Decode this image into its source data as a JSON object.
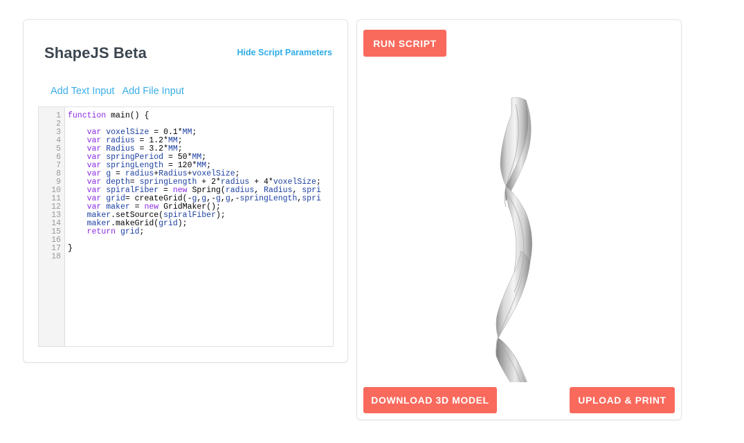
{
  "app": {
    "title": "ShapeJS Beta"
  },
  "left_panel": {
    "hide_params_label": "Hide Script Parameters",
    "add_text_input_label": "Add Text Input",
    "add_file_input_label": "Add File Input"
  },
  "editor": {
    "line_numbers": [
      "1",
      "2",
      "3",
      "4",
      "5",
      "6",
      "7",
      "8",
      "9",
      "10",
      "11",
      "12",
      "13",
      "14",
      "15",
      "16",
      "17",
      "18"
    ],
    "lines": [
      "function main() {",
      "",
      "    var voxelSize = 0.1*MM;",
      "    var radius = 1.2*MM;",
      "    var Radius = 3.2*MM;",
      "    var springPeriod = 50*MM;",
      "    var springLength = 120*MM;",
      "    var g = radius+Radius+voxelSize;",
      "    var depth= springLength + 2*radius + 4*voxelSize;",
      "    var spiralFiber = new Spring(radius, Radius, spri",
      "    var grid= createGrid(-g,g,-g,g,-springLength,spri",
      "    var maker = new GridMaker();",
      "    maker.setSource(spiralFiber);",
      "    maker.makeGrid(grid);",
      "    return grid;",
      "",
      "}",
      ""
    ]
  },
  "right_panel": {
    "run_script_label": "RUN SCRIPT",
    "download_label": "DOWNLOAD 3D MODEL",
    "upload_label": "UPLOAD & PRINT",
    "model_name": "spiral-fiber-spring-3d-model"
  },
  "colors": {
    "accent_button": "#f96a5d",
    "link_blue": "#3aaee8",
    "link_blue_bold": "#2eade8",
    "title_text": "#3c4650",
    "panel_border": "#e3e3e3",
    "gutter_bg": "#f4f4f4",
    "gutter_text": "#999999",
    "code_keyword": "#8a2be2",
    "code_variable": "#1b3fa0",
    "code_plain": "#000000",
    "model_light": "#f2f2f2",
    "model_mid": "#b8b8b8",
    "model_dark": "#7a7a7a"
  }
}
